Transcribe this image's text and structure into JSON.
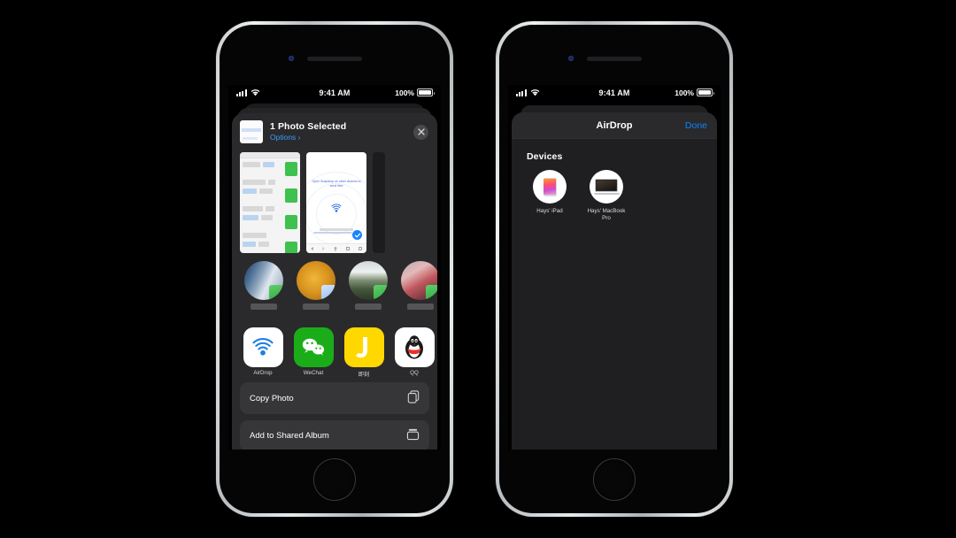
{
  "statusbar": {
    "time": "9:41 AM",
    "battery_percent": "100%",
    "signal_icon": "cellular-bars-icon",
    "wifi_icon": "wifi-icon",
    "battery_icon": "battery-full-icon"
  },
  "left_phone": {
    "share_sheet": {
      "title": "1 Photo Selected",
      "options_link": "Options ›",
      "close_icon": "close-icon",
      "thumbnail_name": "selected-photo-thumbnail",
      "photos": [
        {
          "name": "chat-screenshot-thumbnail",
          "selected": false
        },
        {
          "name": "snapdrop-screenshot-thumbnail",
          "selected": true,
          "caption": "Open Snapdrop on other devices to send files",
          "radar_icon": "airdrop-radar-icon",
          "check_icon": "checkmark-icon"
        }
      ],
      "contacts": [
        {
          "name": "contact-avatar-1"
        },
        {
          "name": "contact-avatar-2"
        },
        {
          "name": "contact-avatar-3"
        },
        {
          "name": "contact-avatar-4"
        },
        {
          "name": "contact-avatar-5"
        }
      ],
      "apps": [
        {
          "label": "AirDrop",
          "icon": "airdrop-icon"
        },
        {
          "label": "WeChat",
          "icon": "wechat-icon"
        },
        {
          "label": "即刻",
          "icon": "jike-icon"
        },
        {
          "label": "QQ",
          "icon": "qq-icon"
        },
        {
          "label": "",
          "icon": "photos-app-icon"
        }
      ],
      "actions": [
        {
          "label": "Copy Photo",
          "icon": "copy-icon"
        },
        {
          "label": "Add to Shared Album",
          "icon": "shared-album-icon"
        }
      ]
    }
  },
  "right_phone": {
    "airdrop_sheet": {
      "title": "AirDrop",
      "done_label": "Done",
      "section_title": "Devices",
      "devices": [
        {
          "name": "Hays' iPad",
          "icon": "ipad-icon"
        },
        {
          "name": "Hays' MacBook Pro",
          "icon": "macbook-pro-icon"
        }
      ]
    }
  },
  "colors": {
    "accent_blue": "#0a84ff",
    "sheet_bg": "#2a2a2c",
    "airdrop_sheet_bg": "#1f1f21",
    "wechat_green": "#1aad19",
    "jike_yellow": "#ffd800"
  }
}
